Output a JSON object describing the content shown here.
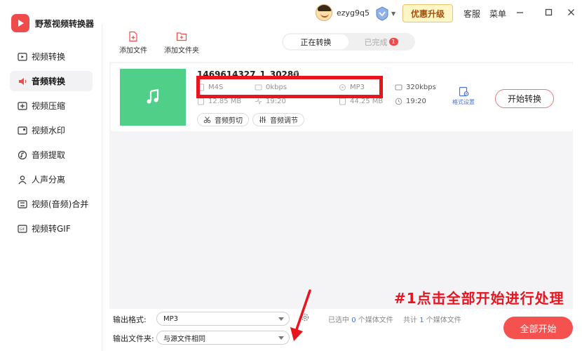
{
  "app": {
    "title": "野葱视频转换器"
  },
  "header": {
    "username": "ezyg9q5",
    "upgrade_label": "优惠升级",
    "service_label": "客服",
    "menu_label": "菜单"
  },
  "sidebar": {
    "items": [
      {
        "label": "视频转换",
        "icon": "video-convert-icon"
      },
      {
        "label": "音频转换",
        "icon": "audio-convert-icon"
      },
      {
        "label": "视频压缩",
        "icon": "video-compress-icon"
      },
      {
        "label": "视频水印",
        "icon": "video-watermark-icon"
      },
      {
        "label": "音频提取",
        "icon": "audio-extract-icon"
      },
      {
        "label": "人声分离",
        "icon": "voice-separate-icon"
      },
      {
        "label": "视频(音频)合并",
        "icon": "merge-icon"
      },
      {
        "label": "视频转GIF",
        "icon": "gif-icon"
      }
    ],
    "active_index": 1
  },
  "toolbar": {
    "add_file": "添加文件",
    "add_folder": "添加文件夹"
  },
  "tabs": {
    "converting": "正在转换",
    "done": "已完成",
    "done_count": "1"
  },
  "file": {
    "name": "1469614327_1_30280",
    "source": {
      "format": "M4S",
      "bitrate": "0kbps",
      "size": "12.85 MB",
      "duration": "19:20"
    },
    "target": {
      "format": "MP3",
      "bitrate": "320kbps",
      "size": "44.25 MB",
      "duration": "19:20"
    },
    "audio_cut": "音频剪切",
    "audio_adjust": "音频调节",
    "format_settings": "格式设置",
    "start_label": "开始转换"
  },
  "bottom": {
    "output_format_label": "输出格式:",
    "output_format_value": "MP3",
    "output_folder_label": "输出文件夹:",
    "output_folder_value": "与源文件相同",
    "selected_prefix": "已选中",
    "selected_count": "0",
    "selected_suffix": "个媒体文件",
    "total_prefix": "共计",
    "total_count": "1",
    "total_suffix": "个媒体文件",
    "start_all_label": "全部开始"
  },
  "annotation": {
    "text": "#1点击全部开始进行处理"
  },
  "colors": {
    "accent_red": "#f4514f",
    "highlight_red": "#e8141e",
    "thumb_green": "#4fcf88",
    "link_blue": "#4a72d8"
  }
}
